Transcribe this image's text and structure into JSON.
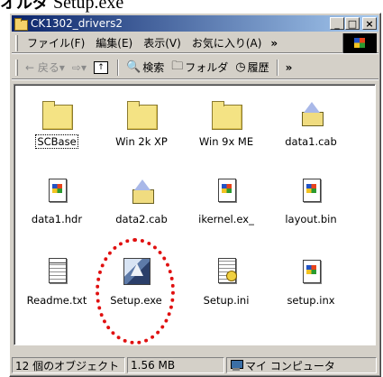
{
  "doc_heading": {
    "prefix": "オルダ",
    "filename": "Setup.exe"
  },
  "window": {
    "title": "CK1302_drivers2",
    "controls": {
      "minimize": "_",
      "maximize": "□",
      "close": "×"
    }
  },
  "menu": {
    "items": [
      "ファイル(F)",
      "編集(E)",
      "表示(V)",
      "お気に入り(A)"
    ],
    "more": "»"
  },
  "toolbar": {
    "back": "← 戻る",
    "back_arrow": "▾",
    "forward": "⇨",
    "forward_arrow": "▾",
    "search": "検索",
    "folders": "フォルダ",
    "history": "履歴",
    "more": "»",
    "icons": {
      "up": "up-folder-icon",
      "search": "search-icon",
      "folders": "folders-icon",
      "history": "history-icon"
    }
  },
  "files": [
    {
      "name": "SCBase",
      "icon": "folder-icon",
      "kind": "folder"
    },
    {
      "name": "Win 2k XP",
      "icon": "folder-icon",
      "kind": "folder"
    },
    {
      "name": "Win 9x ME",
      "icon": "folder-icon",
      "kind": "folder"
    },
    {
      "name": "data1.cab",
      "icon": "cabinet-file-icon",
      "kind": "cab"
    },
    {
      "name": "data1.hdr",
      "icon": "windows-file-icon",
      "kind": "win"
    },
    {
      "name": "data2.cab",
      "icon": "cabinet-file-icon",
      "kind": "cab"
    },
    {
      "name": "ikernel.ex_",
      "icon": "windows-file-icon",
      "kind": "win"
    },
    {
      "name": "layout.bin",
      "icon": "windows-file-icon",
      "kind": "win"
    },
    {
      "name": "Readme.txt",
      "icon": "text-file-icon",
      "kind": "txt"
    },
    {
      "name": "Setup.exe",
      "icon": "setup-exe-icon",
      "kind": "exe"
    },
    {
      "name": "Setup.ini",
      "icon": "ini-file-icon",
      "kind": "ini"
    },
    {
      "name": "setup.inx",
      "icon": "windows-file-icon",
      "kind": "win"
    }
  ],
  "status": {
    "objects": "12 個のオブジェクト",
    "size": "1.56 MB",
    "location": "マイ コンピュータ"
  },
  "colors": {
    "titlebar_start": "#0a246a",
    "titlebar_end": "#a6caf0",
    "highlight": "#e01010"
  }
}
